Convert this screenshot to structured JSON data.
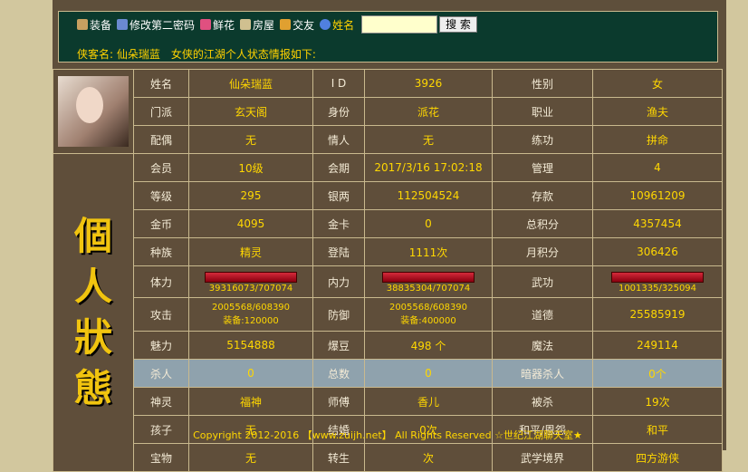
{
  "menu": [
    {
      "label": "装备",
      "icon": "equipment-icon",
      "color": "#c8a060"
    },
    {
      "label": "修改第二密码",
      "icon": "password-icon",
      "color": "#6a8ad0"
    },
    {
      "label": "鲜花",
      "icon": "flower-icon",
      "color": "#e05080"
    },
    {
      "label": "房屋",
      "icon": "house-icon",
      "color": "#d0c090"
    },
    {
      "label": "交友",
      "icon": "gift-icon",
      "color": "#e0a030"
    },
    {
      "label": "姓名",
      "icon": "search-name-icon",
      "color": "#5080e0"
    }
  ],
  "search": {
    "button": "搜 索",
    "value": ""
  },
  "info_line": "侠客名: 仙朵瑞蓝　女侠的江湖个人状态情报如下:",
  "side_title": [
    "個",
    "人",
    "狀",
    "態"
  ],
  "rows": [
    [
      "姓名",
      "仙朵瑞蓝",
      "I D",
      "3926",
      "性别",
      "女"
    ],
    [
      "门派",
      "玄天阁",
      "身份",
      "派花",
      "职业",
      "渔夫"
    ],
    [
      "配偶",
      "无",
      "情人",
      "无",
      "练功",
      "拼命"
    ],
    [
      "会员",
      "10级",
      "会期",
      "2017/3/16 17:02:18",
      "管理",
      "4"
    ],
    [
      "等级",
      "295",
      "银两",
      "112504524",
      "存款",
      "10961209"
    ],
    [
      "金币",
      "4095",
      "金卡",
      "0",
      "总积分",
      "4357454"
    ],
    [
      "种族",
      "精灵",
      "登陆",
      "1111次",
      "月积分",
      "306426"
    ]
  ],
  "bars": {
    "l1": "体力",
    "v1": "39316073/707074",
    "l2": "内力",
    "v2": "38835304/707074",
    "l3": "武功",
    "v3": "1001335/325094"
  },
  "attack": {
    "l1": "攻击",
    "v1a": "2005568/608390",
    "v1b": "装备:120000",
    "l2": "防御",
    "v2a": "2005568/608390",
    "v2b": "装备:400000",
    "l3": "道德",
    "v3": "25585919"
  },
  "rows2": [
    [
      "魅力",
      "5154888",
      "爆豆",
      "498 个",
      "魔法",
      "249114"
    ],
    [
      "杀人",
      "0",
      "总数",
      "0",
      "暗器杀人",
      "0个"
    ],
    [
      "神灵",
      "福神",
      "师傅",
      "香儿",
      "被杀",
      "19次"
    ],
    [
      "孩子",
      "无",
      "结婚",
      "0次",
      "和平/恩怨",
      "和平"
    ],
    [
      "宝物",
      "无",
      "转生",
      "次",
      "武学境界",
      "四方游侠"
    ]
  ],
  "footer": "Copyright 2012-2016 【www.zuijh.net】 All Rights Reserved ☆世纪江湖聊天室★"
}
